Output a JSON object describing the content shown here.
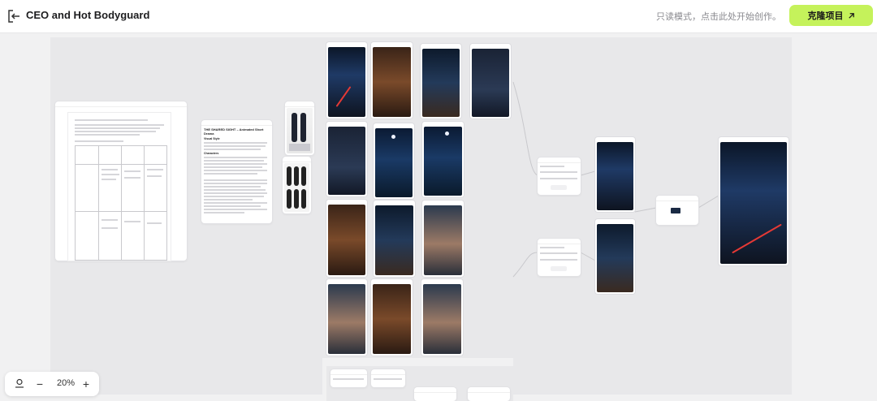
{
  "header": {
    "title": "CEO and Hot Bodyguard",
    "readonly_notice": "只读模式，点击此处开始创作。",
    "clone_label": "克隆项目"
  },
  "story_card": {
    "heading": "THE SHARED SIGHT – Animated Short Drama",
    "visual_style": "Visual Style",
    "characters": "Characters"
  },
  "zoom": {
    "value": "20%"
  },
  "icons": {
    "back": "exit-icon",
    "clone": "arrow-up-right-icon",
    "locate": "locate-pin-icon",
    "zoom_out": "minus-icon",
    "zoom_in": "plus-icon"
  },
  "colors": {
    "accent": "#c5f25b",
    "canvas": "#f1f1f2"
  }
}
